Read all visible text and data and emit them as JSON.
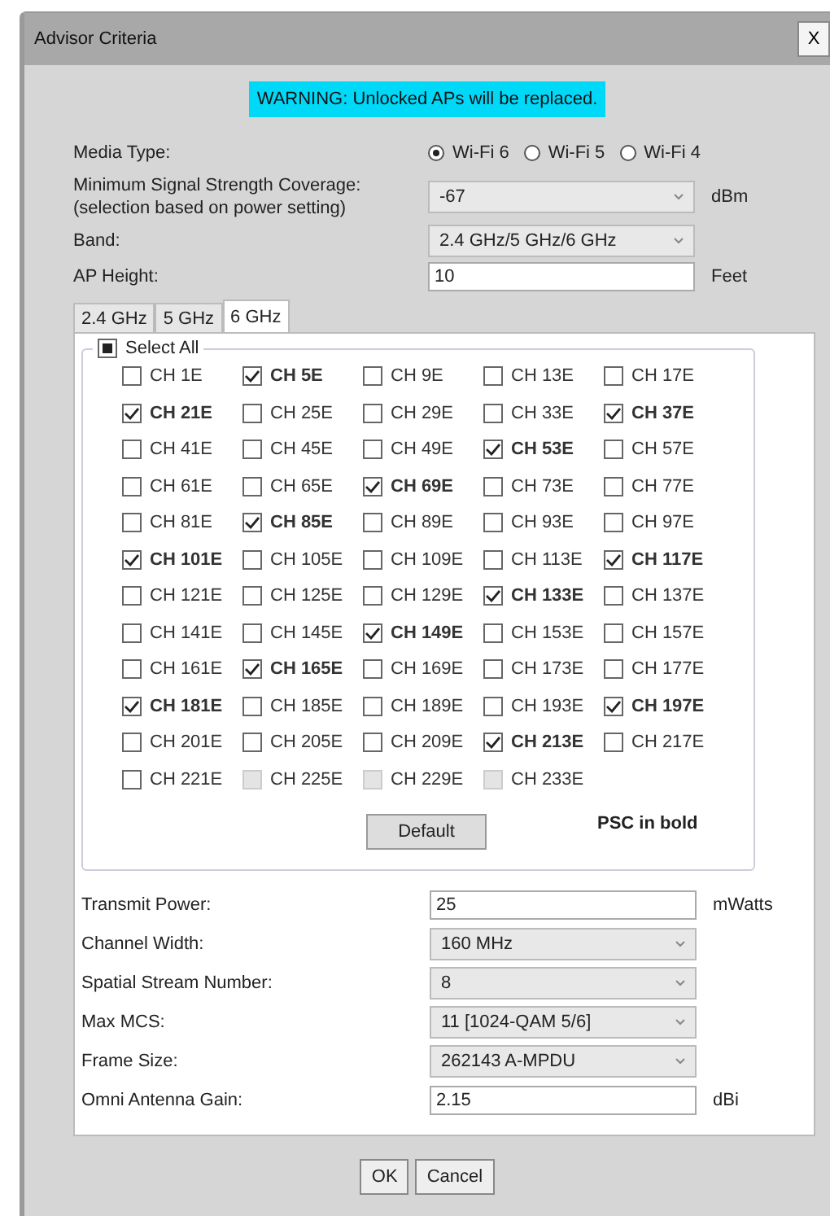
{
  "window": {
    "title": "Advisor Criteria",
    "close": "X"
  },
  "warning": "WARNING: Unlocked APs will be replaced.",
  "media_type": {
    "label": "Media Type:",
    "options": [
      {
        "label": "Wi-Fi 6",
        "selected": true
      },
      {
        "label": "Wi-Fi 5",
        "selected": false
      },
      {
        "label": "Wi-Fi 4",
        "selected": false
      }
    ]
  },
  "top_fields": [
    {
      "kind": "select",
      "label": "Minimum Signal Strength Coverage:",
      "sublabel": "(selection based on power setting)",
      "value": "-67",
      "unit": "dBm"
    },
    {
      "kind": "select",
      "label": "Band:",
      "value": "2.4 GHz/5 GHz/6 GHz"
    },
    {
      "kind": "input",
      "label": "AP Height:",
      "value": "10",
      "unit": "Feet"
    }
  ],
  "tabs": [
    {
      "label": "2.4 GHz",
      "selected": false
    },
    {
      "label": "5 GHz",
      "selected": false
    },
    {
      "label": "6 GHz",
      "selected": true
    }
  ],
  "select_all": {
    "label": "Select All",
    "indeterminate": true
  },
  "channels": [
    {
      "label": "CH 1E",
      "checked": false,
      "psc": false,
      "disabled": false
    },
    {
      "label": "CH 5E",
      "checked": true,
      "psc": true,
      "disabled": false
    },
    {
      "label": "CH 9E",
      "checked": false,
      "psc": false,
      "disabled": false
    },
    {
      "label": "CH 13E",
      "checked": false,
      "psc": false,
      "disabled": false
    },
    {
      "label": "CH 17E",
      "checked": false,
      "psc": false,
      "disabled": false
    },
    {
      "label": "CH 21E",
      "checked": true,
      "psc": true,
      "disabled": false
    },
    {
      "label": "CH 25E",
      "checked": false,
      "psc": false,
      "disabled": false
    },
    {
      "label": "CH 29E",
      "checked": false,
      "psc": false,
      "disabled": false
    },
    {
      "label": "CH 33E",
      "checked": false,
      "psc": false,
      "disabled": false
    },
    {
      "label": "CH 37E",
      "checked": true,
      "psc": true,
      "disabled": false
    },
    {
      "label": "CH 41E",
      "checked": false,
      "psc": false,
      "disabled": false
    },
    {
      "label": "CH 45E",
      "checked": false,
      "psc": false,
      "disabled": false
    },
    {
      "label": "CH 49E",
      "checked": false,
      "psc": false,
      "disabled": false
    },
    {
      "label": "CH 53E",
      "checked": true,
      "psc": true,
      "disabled": false
    },
    {
      "label": "CH 57E",
      "checked": false,
      "psc": false,
      "disabled": false
    },
    {
      "label": "CH 61E",
      "checked": false,
      "psc": false,
      "disabled": false
    },
    {
      "label": "CH 65E",
      "checked": false,
      "psc": false,
      "disabled": false
    },
    {
      "label": "CH 69E",
      "checked": true,
      "psc": true,
      "disabled": false
    },
    {
      "label": "CH 73E",
      "checked": false,
      "psc": false,
      "disabled": false
    },
    {
      "label": "CH 77E",
      "checked": false,
      "psc": false,
      "disabled": false
    },
    {
      "label": "CH 81E",
      "checked": false,
      "psc": false,
      "disabled": false
    },
    {
      "label": "CH 85E",
      "checked": true,
      "psc": true,
      "disabled": false
    },
    {
      "label": "CH 89E",
      "checked": false,
      "psc": false,
      "disabled": false
    },
    {
      "label": "CH 93E",
      "checked": false,
      "psc": false,
      "disabled": false
    },
    {
      "label": "CH 97E",
      "checked": false,
      "psc": false,
      "disabled": false
    },
    {
      "label": "CH 101E",
      "checked": true,
      "psc": true,
      "disabled": false
    },
    {
      "label": "CH 105E",
      "checked": false,
      "psc": false,
      "disabled": false
    },
    {
      "label": "CH 109E",
      "checked": false,
      "psc": false,
      "disabled": false
    },
    {
      "label": "CH 113E",
      "checked": false,
      "psc": false,
      "disabled": false
    },
    {
      "label": "CH 117E",
      "checked": true,
      "psc": true,
      "disabled": false
    },
    {
      "label": "CH 121E",
      "checked": false,
      "psc": false,
      "disabled": false
    },
    {
      "label": "CH 125E",
      "checked": false,
      "psc": false,
      "disabled": false
    },
    {
      "label": "CH 129E",
      "checked": false,
      "psc": false,
      "disabled": false
    },
    {
      "label": "CH 133E",
      "checked": true,
      "psc": true,
      "disabled": false
    },
    {
      "label": "CH 137E",
      "checked": false,
      "psc": false,
      "disabled": false
    },
    {
      "label": "CH 141E",
      "checked": false,
      "psc": false,
      "disabled": false
    },
    {
      "label": "CH 145E",
      "checked": false,
      "psc": false,
      "disabled": false
    },
    {
      "label": "CH 149E",
      "checked": true,
      "psc": true,
      "disabled": false
    },
    {
      "label": "CH 153E",
      "checked": false,
      "psc": false,
      "disabled": false
    },
    {
      "label": "CH 157E",
      "checked": false,
      "psc": false,
      "disabled": false
    },
    {
      "label": "CH 161E",
      "checked": false,
      "psc": false,
      "disabled": false
    },
    {
      "label": "CH 165E",
      "checked": true,
      "psc": true,
      "disabled": false
    },
    {
      "label": "CH 169E",
      "checked": false,
      "psc": false,
      "disabled": false
    },
    {
      "label": "CH 173E",
      "checked": false,
      "psc": false,
      "disabled": false
    },
    {
      "label": "CH 177E",
      "checked": false,
      "psc": false,
      "disabled": false
    },
    {
      "label": "CH 181E",
      "checked": true,
      "psc": true,
      "disabled": false
    },
    {
      "label": "CH 185E",
      "checked": false,
      "psc": false,
      "disabled": false
    },
    {
      "label": "CH 189E",
      "checked": false,
      "psc": false,
      "disabled": false
    },
    {
      "label": "CH 193E",
      "checked": false,
      "psc": false,
      "disabled": false
    },
    {
      "label": "CH 197E",
      "checked": true,
      "psc": true,
      "disabled": false
    },
    {
      "label": "CH 201E",
      "checked": false,
      "psc": false,
      "disabled": false
    },
    {
      "label": "CH 205E",
      "checked": false,
      "psc": false,
      "disabled": false
    },
    {
      "label": "CH 209E",
      "checked": false,
      "psc": false,
      "disabled": false
    },
    {
      "label": "CH 213E",
      "checked": true,
      "psc": true,
      "disabled": false
    },
    {
      "label": "CH 217E",
      "checked": false,
      "psc": false,
      "disabled": false
    },
    {
      "label": "CH 221E",
      "checked": false,
      "psc": false,
      "disabled": false
    },
    {
      "label": "CH 225E",
      "checked": false,
      "psc": false,
      "disabled": true
    },
    {
      "label": "CH 229E",
      "checked": false,
      "psc": false,
      "disabled": true
    },
    {
      "label": "CH 233E",
      "checked": false,
      "psc": false,
      "disabled": true
    }
  ],
  "default_button": "Default",
  "psc_note": "PSC in bold",
  "bottom_fields": [
    {
      "kind": "input",
      "label": "Transmit Power:",
      "value": "25",
      "unit": "mWatts"
    },
    {
      "kind": "select",
      "label": "Channel Width:",
      "value": "160 MHz"
    },
    {
      "kind": "select",
      "label": "Spatial Stream Number:",
      "value": "8"
    },
    {
      "kind": "select",
      "label": "Max MCS:",
      "value": "11 [1024-QAM 5/6]"
    },
    {
      "kind": "select",
      "label": "Frame Size:",
      "value": "262143 A-MPDU"
    },
    {
      "kind": "input",
      "label": "Omni Antenna Gain:",
      "value": "2.15",
      "unit": "dBi"
    }
  ],
  "buttons": [
    "OK",
    "Cancel"
  ]
}
